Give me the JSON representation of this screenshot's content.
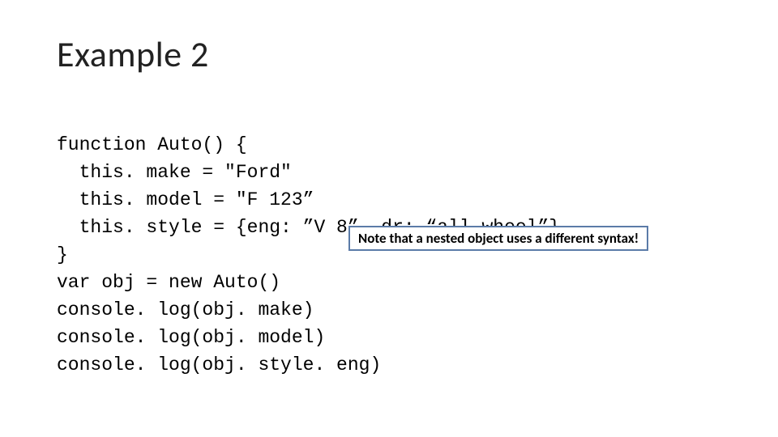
{
  "title": "Example 2",
  "code": {
    "l1": "function Auto() {",
    "l2": "  this. make = \"Ford\"",
    "l3": "  this. model = \"F 123”",
    "l4": "  this. style = {eng: ”V 8”, dr: “all-wheel”}",
    "l5": "}",
    "l6": "var obj = new Auto()",
    "l7": "console. log(obj. make)",
    "l8": "console. log(obj. model)",
    "l9": "console. log(obj. style. eng)"
  },
  "callout": "Note that a nested object uses a different syntax!"
}
